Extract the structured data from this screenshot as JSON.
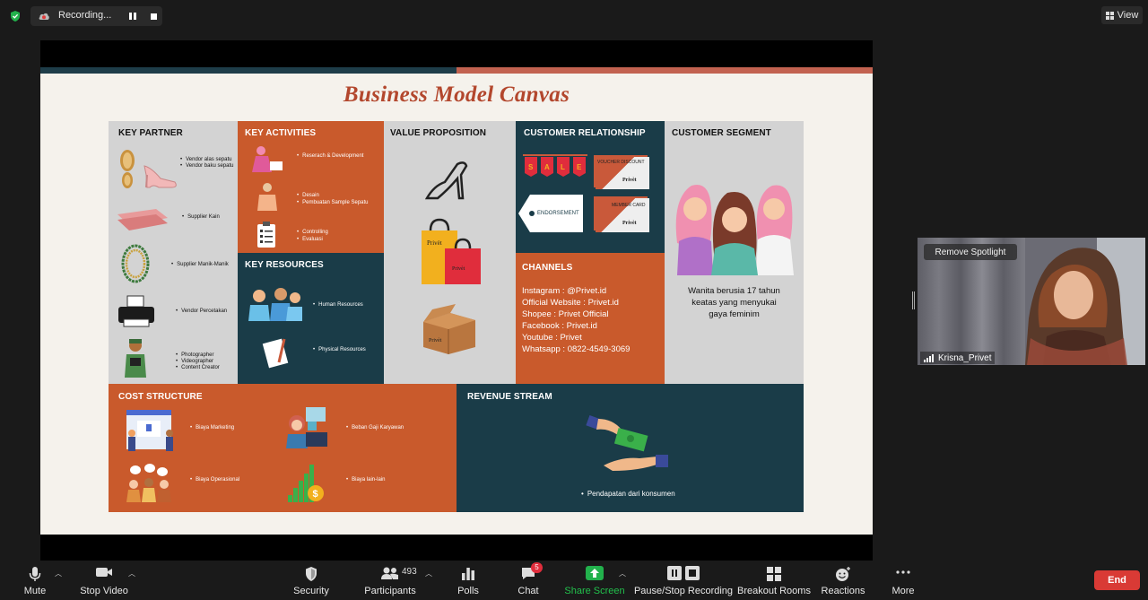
{
  "topbar": {
    "recording_label": "Recording...",
    "view_label": "View"
  },
  "slide": {
    "title": "Business Model Canvas",
    "key_partner": {
      "title": "KEY PARTNER",
      "items": [
        [
          "Vendor alas sepatu",
          "Vendor baku sepatu"
        ],
        "Supplier Kain",
        "Supplier Manik-Manik",
        "Vendor Percetakan",
        [
          "Photographer",
          "Videographer",
          "Content Creator"
        ]
      ]
    },
    "key_activities": {
      "title": "KEY ACTIVITIES",
      "items": [
        [
          "Reserach & Development"
        ],
        [
          "Desain",
          "Pembuatan Sample Sepatu"
        ],
        [
          "Controlling",
          "Evaluasi"
        ]
      ]
    },
    "key_resources": {
      "title": "KEY RESOURCES",
      "items": [
        "Human Resources",
        "Physical Resources"
      ]
    },
    "value_proposition": {
      "title": "VALUE PROPOSITION",
      "bag_label": "Privèt",
      "bag_label_2": "Privèt",
      "box_label": "Privèt"
    },
    "customer_relationship": {
      "title": "CUSTOMER RELATIONSHIP",
      "sale_letters": [
        "S",
        "A",
        "L",
        "E"
      ],
      "voucher_label": "VOUCHER DISCOUNT",
      "voucher_brand": "Privèt",
      "endorsement_label": "ENDORSEMENT",
      "member_label": "MEMBER CARD",
      "member_brand": "Privèt"
    },
    "channels": {
      "title": "CHANNELS",
      "lines": [
        "Instagram : @Privet.id",
        "Official Website : Privet.id",
        "Shopee : Privet Official",
        "Facebook : Privet.id",
        "Youtube : Privet",
        "Whatsapp : 0822-4549-3069"
      ]
    },
    "customer_segment": {
      "title": "CUSTOMER SEGMENT",
      "description": [
        "Wanita berusia 17 tahun",
        "keatas yang  menyukai",
        "gaya feminim"
      ]
    },
    "cost_structure": {
      "title": "COST STRUCTURE",
      "items": [
        "Biaya Marketing",
        "Beban Gaji Karyawan",
        "Biaya Operasional",
        "Biaya lain-lain"
      ]
    },
    "revenue_stream": {
      "title": "REVENUE STREAM",
      "items": [
        "Pendapatan dari konsumen"
      ]
    }
  },
  "video_tile": {
    "spotlight_button": "Remove Spotlight",
    "participant_name": "Krisna_Privet"
  },
  "toolbar": {
    "mute": "Mute",
    "stop_video": "Stop Video",
    "security": "Security",
    "participants": "Participants",
    "participant_count": "493",
    "polls": "Polls",
    "chat": "Chat",
    "chat_badge": "5",
    "share_screen": "Share Screen",
    "pause_recording": "Pause/Stop Recording",
    "breakout_rooms": "Breakout Rooms",
    "reactions": "Reactions",
    "more": "More",
    "end": "End"
  },
  "colors": {
    "accent_green": "#22b14c",
    "end_red": "#d93a35",
    "slide_orange": "#c95a2c",
    "slide_teal": "#1a3c48",
    "slide_gray": "#d3d3d3",
    "title_red": "#b3472d"
  }
}
